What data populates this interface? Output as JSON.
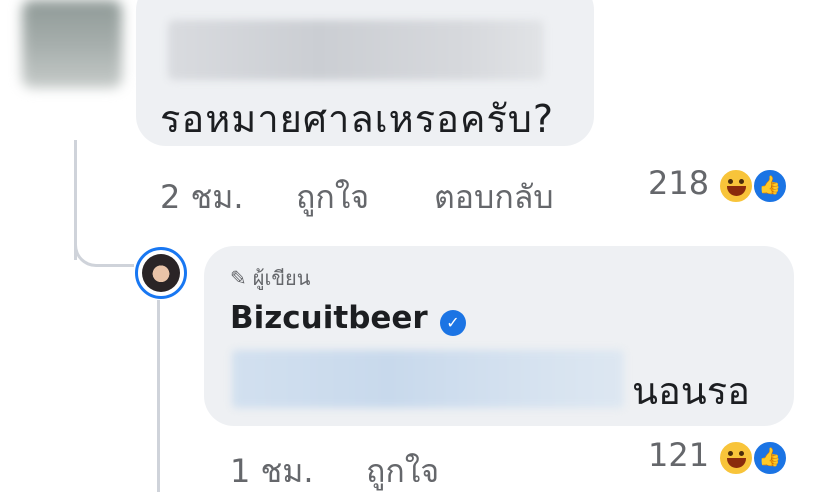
{
  "comment": {
    "text": "รอหมายศาลเหรอครับ?",
    "time": "2 ชม.",
    "like_label": "ถูกใจ",
    "reply_label": "ตอบกลับ",
    "reaction_count": "218",
    "reactions": [
      "haha-icon",
      "like-icon"
    ]
  },
  "reply": {
    "author_badge": "ผู้เขียน",
    "author_name": "Bizcuitbeer",
    "verified": true,
    "text": "นอนรอ",
    "time": "1 ชม.",
    "like_label": "ถูกใจ",
    "reaction_count": "121",
    "reactions": [
      "haha-icon",
      "like-icon"
    ]
  },
  "colors": {
    "bubble": "#eef0f3",
    "meta_text": "#65676b",
    "accent_blue": "#1b74e4",
    "haha_yellow": "#f8c43a"
  }
}
